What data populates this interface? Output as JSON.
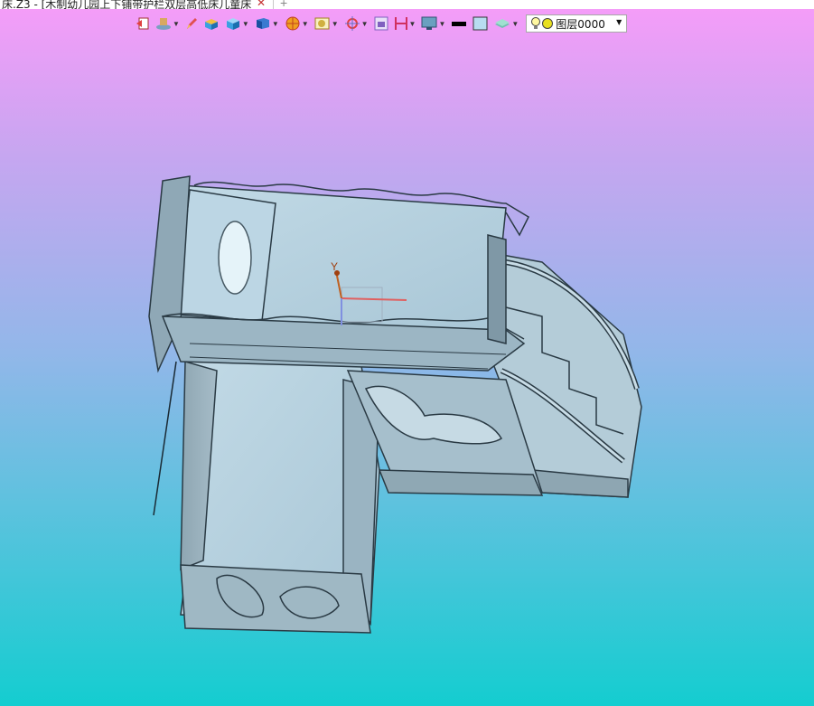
{
  "window": {
    "tab_title": "床.Z3 - [木制幼儿园上下铺带护栏双层高低床儿童床]",
    "close_symbol": "✕",
    "new_tab_symbol": "+"
  },
  "toolbar": {
    "buttons": [
      {
        "name": "exit-sketch-icon",
        "color": "#e04040"
      },
      {
        "name": "wrap-tool-icon",
        "color": "#7aa0c0",
        "dropdown": true
      },
      {
        "name": "pencil-icon",
        "color": "#e05050"
      },
      {
        "name": "solid-box-icon",
        "color": "#f0c040"
      },
      {
        "name": "shaded-cube-icon",
        "color": "#3aa0e0",
        "dropdown": true
      },
      {
        "name": "display-mode-icon",
        "color": "#3a7ad0",
        "dropdown": true
      },
      {
        "name": "view-orient-icon",
        "color": "#f0a020",
        "dropdown": true
      },
      {
        "name": "render-icon",
        "color": "#d0b040",
        "dropdown": true
      },
      {
        "name": "target-icon",
        "color": "#e04040",
        "dropdown": true
      },
      {
        "name": "frame-icon",
        "color": "#8060c0"
      },
      {
        "name": "dimension-icon",
        "color": "#d03060",
        "dropdown": true
      },
      {
        "name": "screen-icon",
        "color": "#4080a0",
        "dropdown": true
      }
    ],
    "line_color": "#000000",
    "fill_color": "#b8dcf0",
    "layer_style_icon": "layer-style-icon",
    "layer_select": {
      "value": "图层0000",
      "bulb_icon": "lightbulb-icon",
      "status_color": "#e8e020"
    }
  },
  "viewport": {
    "axis_label_y": "Y"
  }
}
